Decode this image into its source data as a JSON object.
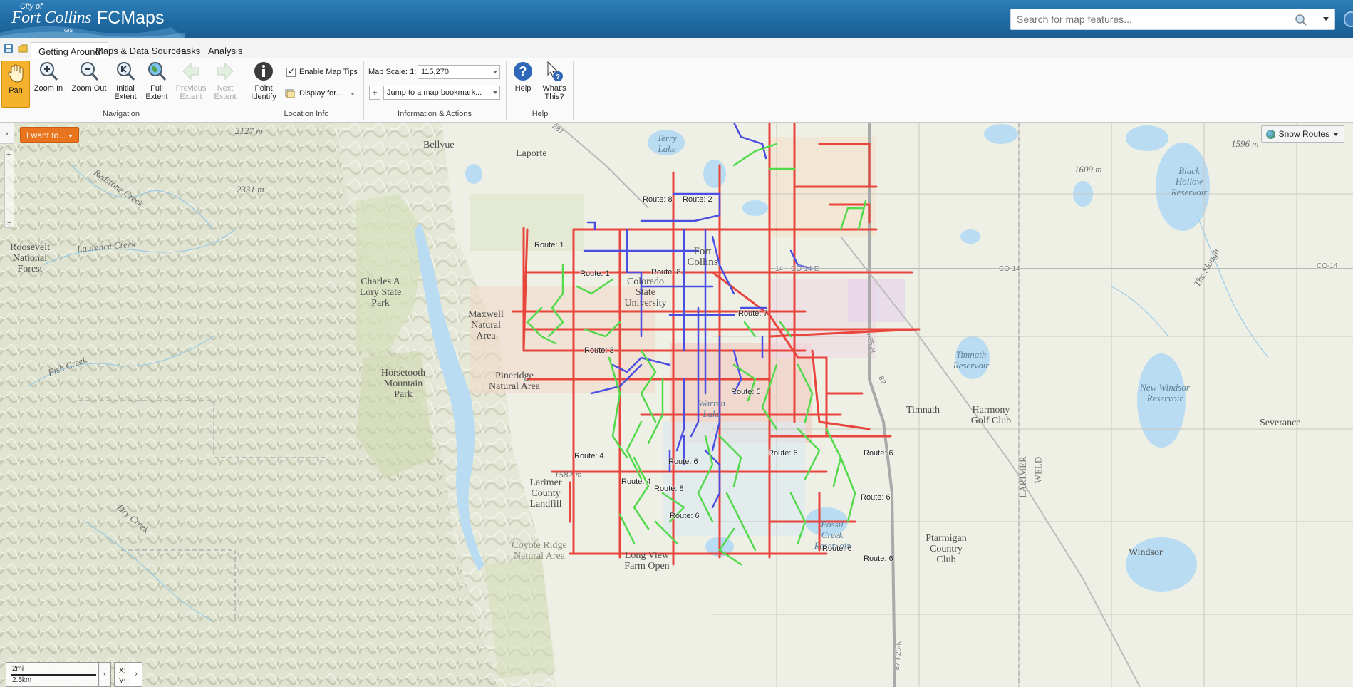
{
  "header": {
    "logo_city": "City of",
    "logo_name": "Fort Collins",
    "logo_sub": "GIS",
    "app_title": "FCMaps",
    "search_placeholder": "Search for map features..."
  },
  "tabs": [
    {
      "label": "Getting Around",
      "active": true
    },
    {
      "label": "Maps & Data Sources",
      "active": false
    },
    {
      "label": "Tasks",
      "active": false
    },
    {
      "label": "Analysis",
      "active": false
    }
  ],
  "ribbon": {
    "navigation": {
      "group_label": "Navigation",
      "pan": "Pan",
      "zoom_in": "Zoom In",
      "zoom_out": "Zoom Out",
      "initial_extent_1": "Initial",
      "initial_extent_2": "Extent",
      "full_extent_1": "Full",
      "full_extent_2": "Extent",
      "previous_extent_1": "Previous",
      "previous_extent_2": "Extent",
      "next_extent_1": "Next",
      "next_extent_2": "Extent"
    },
    "location_info": {
      "group_label": "Location Info",
      "point_identify_1": "Point",
      "point_identify_2": "Identify",
      "enable_map_tips": "Enable Map Tips",
      "display_for": "Display for..."
    },
    "info_actions": {
      "group_label": "Information & Actions",
      "map_scale_label": "Map Scale: 1:",
      "map_scale_value": "115,270",
      "bookmark_placeholder": "Jump to a map bookmark..."
    },
    "help": {
      "group_label": "Help",
      "help": "Help",
      "whats_this_1": "What's",
      "whats_this_2": "This?"
    }
  },
  "map": {
    "i_want_to": "I want to...",
    "layer_button": "Snow Routes",
    "scale_mi": "2mi",
    "scale_km": "2.5km",
    "coord_x": "X:",
    "coord_y": "Y:",
    "places": {
      "bellvue": "Bellvue",
      "laporte": "Laporte",
      "terry_lake": "Terry Lake",
      "roosevelt": "Roosevelt National Forest",
      "charles_a_lory": "Charles A Lory State Park",
      "maxwell": "Maxwell Natural Area",
      "horsetooth": "Horsetooth Mountain Park",
      "pineridge": "Pineridge Natural Area",
      "fort_collins": "Fort Collins",
      "csu": "Colorado State University",
      "warren_lake": "Warren Lake",
      "timnath": "Timnath",
      "timnath_reservoir": "Timnath Reservoir",
      "harmony": "Harmony Golf Club",
      "new_windsor": "New Windsor Reservoir",
      "severance": "Severance",
      "black_hollow": "Black Hollow Reservoir",
      "larimer_county_landfill": "Larimer County Landfill",
      "fossil_creek": "Fossil Creek Reservoir",
      "ptarmigan": "Ptarmigan Country Club",
      "windsor": "Windsor",
      "coyote_ridge": "Coyote Ridge Natural Area",
      "long_view": "Long View Farm Open",
      "larimer": "LARIMER",
      "weld": "WELD",
      "redstone": "Redstone Creek",
      "lawrence": "Laurence Creek",
      "fish_creek": "Fish Creek",
      "dry_creek": "Dry Creek",
      "the_slough": "The Slough",
      "co14_a": "CO-14-E",
      "co14_b": "CO-14",
      "co14_c": "CO-14",
      "i25": "I-25-N",
      "i25b": "87-I-25-N",
      "r287": "287",
      "r87": "87",
      "r14": "14",
      "elev1": "2127 m",
      "elev2": "2331 m",
      "elev3": "1609 m",
      "elev4": "1596 m",
      "elev5": "1582 m"
    },
    "routes": [
      {
        "label": "Route: 8"
      },
      {
        "label": "Route: 2"
      },
      {
        "label": "Route: 1"
      },
      {
        "label": "Route: 1"
      },
      {
        "label": "Route: 8"
      },
      {
        "label": "Route: 7"
      },
      {
        "label": "Route: 3"
      },
      {
        "label": "Route: 5"
      },
      {
        "label": "Route: 4"
      },
      {
        "label": "Route: 6"
      },
      {
        "label": "Route: 6"
      },
      {
        "label": "Route: 6"
      },
      {
        "label": "Route: 4"
      },
      {
        "label": "Route: 8"
      },
      {
        "label": "Route: 6"
      },
      {
        "label": "Route: 6"
      },
      {
        "label": "Route: 6"
      },
      {
        "label": "Route: 6"
      }
    ],
    "colors": {
      "route_red": "#e8453c",
      "route_blue": "#4b4ee0",
      "route_green": "#52d94a",
      "water": "#b9dcf2"
    }
  }
}
